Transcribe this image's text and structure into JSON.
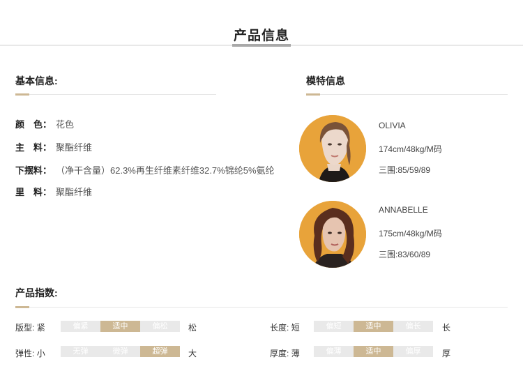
{
  "header": {
    "title": "产品信息"
  },
  "basic": {
    "heading": "基本信息:",
    "rows": [
      {
        "label": "颜　色：",
        "value": "花色"
      },
      {
        "label": "主　料：",
        "value": "聚酯纤维"
      },
      {
        "label": "下摆料：",
        "value": "（净干含量）62.3%再生纤维素纤维32.7%锦纶5%氨纶"
      },
      {
        "label": "里　料：",
        "value": "聚酯纤维"
      }
    ]
  },
  "models": {
    "heading": "模特信息",
    "items": [
      {
        "name": "OLIVIA",
        "size": "174cm/48kg/M码",
        "measure": "三围:85/59/89"
      },
      {
        "name": "ANNABELLE",
        "size": "175cm/48kg/M码",
        "measure": "三围:83/60/89"
      }
    ]
  },
  "indices": {
    "heading": "产品指数:",
    "items": [
      {
        "label": "版型:",
        "low": "紧",
        "high": "松",
        "segments": [
          "偏紧",
          "适中",
          "偏松"
        ],
        "selected": 1
      },
      {
        "label": "长度:",
        "low": "短",
        "high": "长",
        "segments": [
          "偏短",
          "适中",
          "偏长"
        ],
        "selected": 1
      },
      {
        "label": "弹性:",
        "low": "小",
        "high": "大",
        "segments": [
          "无弹",
          "微弹",
          "超弹"
        ],
        "selected": 2
      },
      {
        "label": "厚度:",
        "low": "薄",
        "high": "厚",
        "segments": [
          "偏薄",
          "适中",
          "偏厚"
        ],
        "selected": 1
      }
    ]
  },
  "colors": {
    "accent": "#cdb894",
    "avatar_bg": "#e8a33a",
    "segment_bg": "#e9e9e9"
  }
}
